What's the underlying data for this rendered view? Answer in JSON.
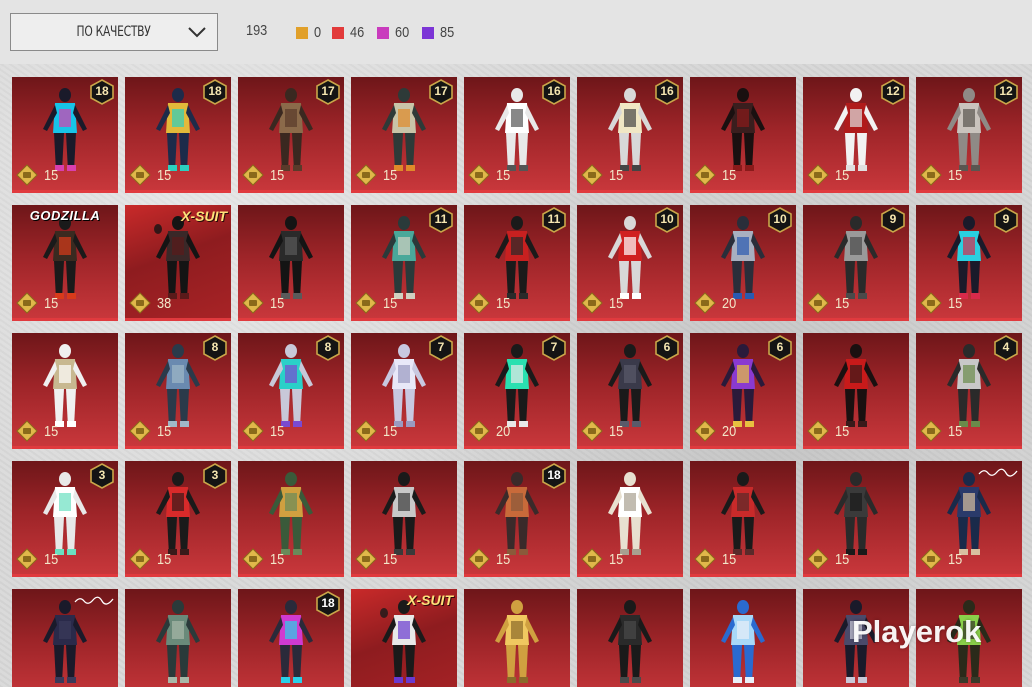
{
  "filter": {
    "sort_label": "по качеству",
    "total_count": "193",
    "stats": [
      {
        "color": "#e1a02a",
        "count": "0"
      },
      {
        "color": "#e23a3a",
        "count": "46"
      },
      {
        "color": "#c93bbd",
        "count": "60"
      },
      {
        "color": "#7c35d6",
        "count": "85"
      }
    ]
  },
  "items": [
    {
      "level": "18",
      "price": "15",
      "tag": "",
      "palette": [
        "#1a1a2a",
        "#18c4e8",
        "#d93fae"
      ]
    },
    {
      "level": "18",
      "price": "15",
      "tag": "",
      "palette": [
        "#1d2b4a",
        "#e2b93a",
        "#2bd0c0"
      ]
    },
    {
      "level": "17",
      "price": "15",
      "tag": "",
      "palette": [
        "#3a2820",
        "#8b6a4a",
        "#5a3a2a"
      ]
    },
    {
      "level": "17",
      "price": "15",
      "tag": "",
      "palette": [
        "#2e3a38",
        "#c9c4a8",
        "#e08a2a"
      ]
    },
    {
      "level": "16",
      "price": "15",
      "tag": "",
      "palette": [
        "#e8e8e8",
        "#ffffff",
        "#555555"
      ]
    },
    {
      "level": "16",
      "price": "15",
      "tag": "",
      "palette": [
        "#d8d8d8",
        "#f0e7c4",
        "#444444"
      ]
    },
    {
      "level": "",
      "price": "15",
      "tag": "",
      "palette": [
        "#1a1010",
        "#3a1e1e",
        "#8a1a1a"
      ]
    },
    {
      "level": "12",
      "price": "15",
      "tag": "",
      "palette": [
        "#f2f2f2",
        "#b01b1b",
        "#e0e0e0"
      ]
    },
    {
      "level": "12",
      "price": "15",
      "tag": "",
      "palette": [
        "#8f8a86",
        "#c9c3bd",
        "#5a5550"
      ]
    },
    {
      "level": "",
      "price": "15",
      "tag": "GODZILLA",
      "palette": [
        "#1a1a1a",
        "#3a2a20",
        "#d83a1a"
      ]
    },
    {
      "level": "",
      "price": "38",
      "tag": "X-SUIT",
      "palette": [
        "#141414",
        "#3a2828",
        "#5a1a1a"
      ]
    },
    {
      "level": "",
      "price": "15",
      "tag": "",
      "palette": [
        "#141414",
        "#2a2a2a",
        "#5a5a5a"
      ]
    },
    {
      "level": "11",
      "price": "15",
      "tag": "",
      "palette": [
        "#2a3a3a",
        "#4aa89a",
        "#d0d0c0"
      ]
    },
    {
      "level": "11",
      "price": "15",
      "tag": "",
      "palette": [
        "#1a1a1a",
        "#c82020",
        "#2a2a2a"
      ]
    },
    {
      "level": "10",
      "price": "15",
      "tag": "",
      "palette": [
        "#d8d8d8",
        "#d02020",
        "#ffffff"
      ]
    },
    {
      "level": "10",
      "price": "20",
      "tag": "",
      "palette": [
        "#2a2e3a",
        "#a8b0c0",
        "#2a5ab0"
      ]
    },
    {
      "level": "9",
      "price": "15",
      "tag": "",
      "palette": [
        "#2a2a2a",
        "#9a9a9a",
        "#4a4a4a"
      ]
    },
    {
      "level": "9",
      "price": "15",
      "tag": "",
      "palette": [
        "#1a1a2a",
        "#2ad0e0",
        "#d82a4a"
      ]
    },
    {
      "level": "",
      "price": "15",
      "tag": "",
      "palette": [
        "#f0f0f0",
        "#c8b890",
        "#ffffff"
      ]
    },
    {
      "level": "8",
      "price": "15",
      "tag": "",
      "palette": [
        "#2a3a4a",
        "#6a8ab0",
        "#a0b8c8"
      ]
    },
    {
      "level": "8",
      "price": "15",
      "tag": "",
      "palette": [
        "#c8c8d8",
        "#2ad0c8",
        "#7a4ad0"
      ]
    },
    {
      "level": "7",
      "price": "15",
      "tag": "",
      "palette": [
        "#c8c8e0",
        "#e8e8f8",
        "#9a9ac0"
      ]
    },
    {
      "level": "7",
      "price": "20",
      "tag": "",
      "palette": [
        "#1a1a1a",
        "#2ae0b0",
        "#e8e8e8"
      ]
    },
    {
      "level": "6",
      "price": "15",
      "tag": "",
      "palette": [
        "#1a1a1a",
        "#3a3a4a",
        "#5a5a6a"
      ]
    },
    {
      "level": "6",
      "price": "20",
      "tag": "",
      "palette": [
        "#2a1a3a",
        "#8a3ad0",
        "#e8c040"
      ]
    },
    {
      "level": "",
      "price": "15",
      "tag": "",
      "palette": [
        "#1a1010",
        "#c81a1a",
        "#3a1a1a"
      ]
    },
    {
      "level": "4",
      "price": "15",
      "tag": "",
      "palette": [
        "#2a2a2a",
        "#c8c8c8",
        "#6a8a4a"
      ]
    },
    {
      "level": "3",
      "price": "15",
      "tag": "",
      "palette": [
        "#e8e8e8",
        "#ffffff",
        "#6ae0c0"
      ]
    },
    {
      "level": "3",
      "price": "15",
      "tag": "",
      "palette": [
        "#1a1a1a",
        "#d82a2a",
        "#3a1a1a"
      ]
    },
    {
      "level": "",
      "price": "15",
      "tag": "",
      "palette": [
        "#3a5a3a",
        "#d0a040",
        "#6a8a5a"
      ]
    },
    {
      "level": "",
      "price": "15",
      "tag": "",
      "palette": [
        "#1a1a1a",
        "#c8c8c8",
        "#3a3a3a"
      ]
    },
    {
      "level": "18",
      "price": "15",
      "tag": "",
      "palette": [
        "#3a2a2a",
        "#c86a3a",
        "#8a5a3a"
      ]
    },
    {
      "level": "",
      "price": "15",
      "tag": "",
      "palette": [
        "#e8e0d0",
        "#ffffff",
        "#a8a090"
      ]
    },
    {
      "level": "",
      "price": "15",
      "tag": "",
      "palette": [
        "#1a1a1a",
        "#c82a2a",
        "#5a2a2a"
      ]
    },
    {
      "level": "",
      "price": "15",
      "tag": "",
      "palette": [
        "#2a2a2a",
        "#3a3a3a",
        "#1a1a1a"
      ]
    },
    {
      "level": "",
      "price": "15",
      "tag": "sign",
      "palette": [
        "#1a2a4a",
        "#2a3a6a",
        "#d8c0a0"
      ]
    },
    {
      "level": "",
      "price": "",
      "tag": "sign",
      "palette": [
        "#1a1a2a",
        "#2a2a4a",
        "#3a3a5a"
      ]
    },
    {
      "level": "",
      "price": "",
      "tag": "",
      "palette": [
        "#2a3a3a",
        "#6a8a7a",
        "#a8b8a8"
      ]
    },
    {
      "level": "18",
      "price": "",
      "tag": "",
      "palette": [
        "#2a2a3a",
        "#d03ad0",
        "#2ad0e8"
      ]
    },
    {
      "level": "",
      "price": "",
      "tag": "X-SUIT",
      "palette": [
        "#1a1a1a",
        "#e8e8e8",
        "#6a3ad0"
      ]
    },
    {
      "level": "",
      "price": "",
      "tag": "",
      "palette": [
        "#d0a040",
        "#f0c860",
        "#8a6a2a"
      ]
    },
    {
      "level": "",
      "price": "",
      "tag": "",
      "palette": [
        "#1a1a1a",
        "#2a2a2a",
        "#4a4a4a"
      ]
    },
    {
      "level": "",
      "price": "",
      "tag": "",
      "palette": [
        "#2a6ad0",
        "#a8d8f8",
        "#e8f0f8"
      ]
    },
    {
      "level": "",
      "price": "",
      "tag": "",
      "palette": [
        "#1a1a2a",
        "#4a4a6a",
        "#c8c8d8"
      ]
    },
    {
      "level": "",
      "price": "",
      "tag": "",
      "palette": [
        "#2a2a1a",
        "#8ad04a",
        "#3a3a2a"
      ]
    }
  ],
  "overlay": {
    "watermark": "Playerok"
  }
}
